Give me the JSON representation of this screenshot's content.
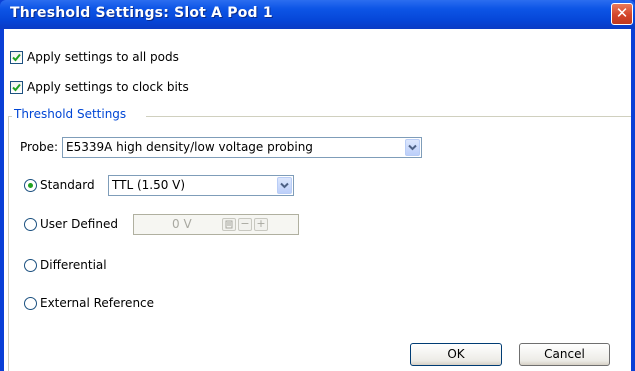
{
  "window": {
    "title": "Threshold Settings: Slot A Pod 1",
    "close_glyph": "✕"
  },
  "options": {
    "apply_all_pods": {
      "label": "Apply settings to all pods",
      "checked": true
    },
    "apply_clock_bits": {
      "label": "Apply settings to clock bits",
      "checked": true
    }
  },
  "group": {
    "title": "Threshold Settings",
    "probe_label": "Probe:",
    "probe_value": "E5339A high density/low voltage probing"
  },
  "thresholds": {
    "selected": "standard",
    "standard_label": "Standard",
    "standard_value": "TTL (1.50 V)",
    "user_defined_label": "User Defined",
    "user_defined_value": "0 V",
    "spin_minus": "−",
    "spin_plus": "+",
    "differential_label": "Differential",
    "external_reference_label": "External Reference"
  },
  "buttons": {
    "ok": "OK",
    "cancel": "Cancel"
  },
  "icons": {
    "close": "close-icon",
    "check": "checkmark-icon",
    "dropdown": "chevron-down-icon",
    "keypad": "keypad-icon"
  },
  "colors": {
    "titlebar": "#0a52e0",
    "group_title": "#0046d5",
    "radio_selected": "#21a121",
    "close_button": "#d3452a"
  }
}
